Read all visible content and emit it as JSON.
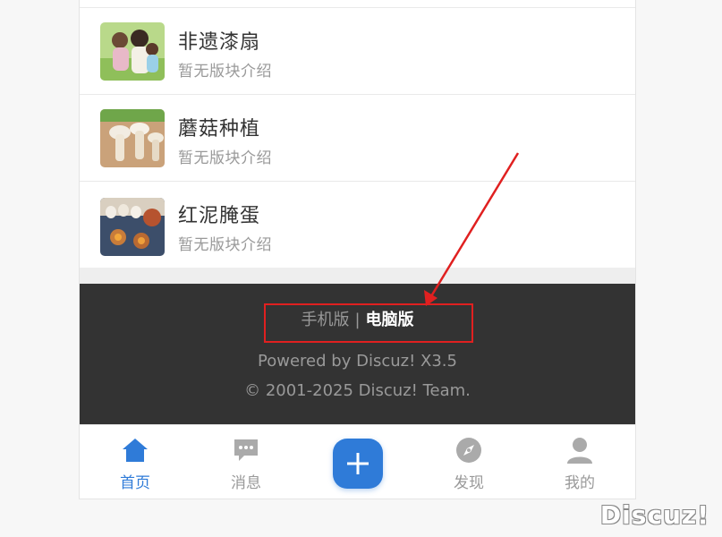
{
  "forums": [
    {
      "name": "非遗漆扇",
      "desc": "暂无版块介绍",
      "thumb_icon": "family-photo-icon"
    },
    {
      "name": "蘑菇种植",
      "desc": "暂无版块介绍",
      "thumb_icon": "mushroom-photo-icon"
    },
    {
      "name": "红泥腌蛋",
      "desc": "暂无版块介绍",
      "thumb_icon": "eggs-photo-icon"
    }
  ],
  "footer": {
    "mobile_label": "手机版",
    "separator": "|",
    "pc_label": "电脑版",
    "powered": "Powered by Discuz! X3.5",
    "copyright": "© 2001-2025 Discuz! Team."
  },
  "tabbar": {
    "home": "首页",
    "messages": "消息",
    "discover": "发现",
    "mine": "我的"
  },
  "watermark": "Discuz!",
  "colors": {
    "accent": "#2f7bd8",
    "footer_bg": "#333333",
    "annotation": "#e02020"
  }
}
